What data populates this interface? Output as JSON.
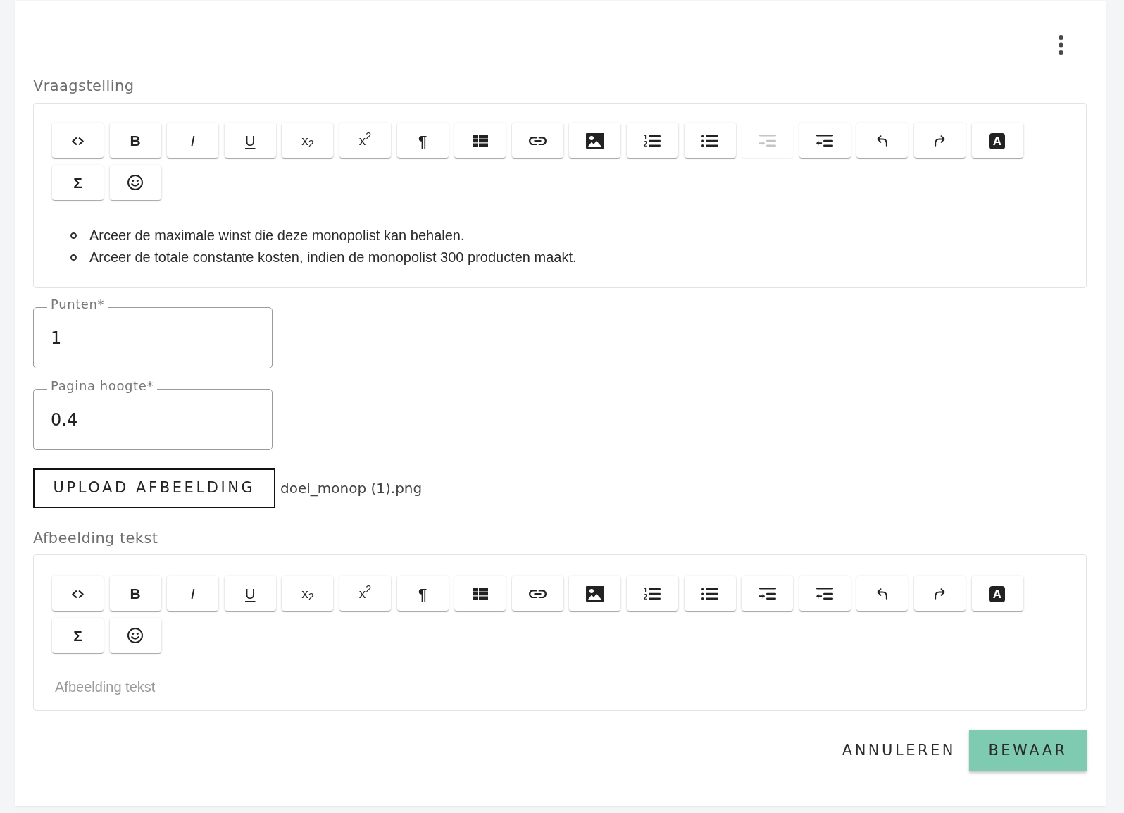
{
  "question": {
    "label": "Vraagstelling",
    "toolbar": [
      {
        "kind": "code",
        "disabled": false
      },
      {
        "kind": "bold",
        "label": "B",
        "disabled": false
      },
      {
        "kind": "italic",
        "label": "I",
        "disabled": false
      },
      {
        "kind": "underline",
        "label": "U",
        "disabled": false
      },
      {
        "kind": "subscript",
        "label": "x$_{2}$",
        "disabled": false
      },
      {
        "kind": "superscript",
        "label": "x$^{2}$",
        "disabled": false
      },
      {
        "kind": "paragraph",
        "label": "¶",
        "disabled": false
      },
      {
        "kind": "table",
        "disabled": false
      },
      {
        "kind": "link",
        "disabled": false
      },
      {
        "kind": "image",
        "disabled": false
      },
      {
        "kind": "numbered_list",
        "disabled": false
      },
      {
        "kind": "bullet_list",
        "disabled": false
      },
      {
        "kind": "indent",
        "disabled": true
      },
      {
        "kind": "outdent",
        "disabled": false
      },
      {
        "kind": "undo",
        "disabled": false
      },
      {
        "kind": "redo",
        "disabled": false
      },
      {
        "kind": "text_color",
        "label": "A",
        "disabled": false
      },
      {
        "kind": "formula",
        "label": "Σ",
        "disabled": false
      },
      {
        "kind": "emoji",
        "disabled": false
      }
    ],
    "list_items": [
      "Arceer de maximale winst die deze monopolist kan behalen.",
      "Arceer de totale constante kosten, indien de monopolist 300 producten maakt."
    ]
  },
  "fields": [
    {
      "label": "Punten*",
      "value": "1"
    },
    {
      "label": "Pagina hoogte*",
      "value": "0.4"
    }
  ],
  "upload": {
    "button": "UPLOAD AFBEELDING",
    "filename": "doel_monop (1).png"
  },
  "image_text": {
    "label": "Afbeelding tekst",
    "toolbar": [
      {
        "kind": "code",
        "disabled": false
      },
      {
        "kind": "bold",
        "label": "B",
        "disabled": false
      },
      {
        "kind": "italic",
        "label": "I",
        "disabled": false
      },
      {
        "kind": "underline",
        "label": "U",
        "disabled": false
      },
      {
        "kind": "subscript",
        "label": "x$_{2}$",
        "disabled": false
      },
      {
        "kind": "superscript",
        "label": "x$^{2}$",
        "disabled": false
      },
      {
        "kind": "paragraph",
        "label": "¶",
        "disabled": false
      },
      {
        "kind": "table",
        "disabled": false
      },
      {
        "kind": "link",
        "disabled": false
      },
      {
        "kind": "image",
        "disabled": false
      },
      {
        "kind": "numbered_list",
        "disabled": false
      },
      {
        "kind": "bullet_list",
        "disabled": false
      },
      {
        "kind": "indent",
        "disabled": false
      },
      {
        "kind": "outdent",
        "disabled": false
      },
      {
        "kind": "undo",
        "disabled": false
      },
      {
        "kind": "redo",
        "disabled": false
      },
      {
        "kind": "text_color",
        "label": "A",
        "disabled": false
      },
      {
        "kind": "formula",
        "label": "Σ",
        "disabled": false
      },
      {
        "kind": "emoji",
        "disabled": false
      }
    ],
    "placeholder": "Afbeelding tekst"
  },
  "actions": [
    {
      "kind": "text",
      "label": "ANNULEREN"
    },
    {
      "kind": "contained",
      "label": "BEWAAR"
    }
  ]
}
